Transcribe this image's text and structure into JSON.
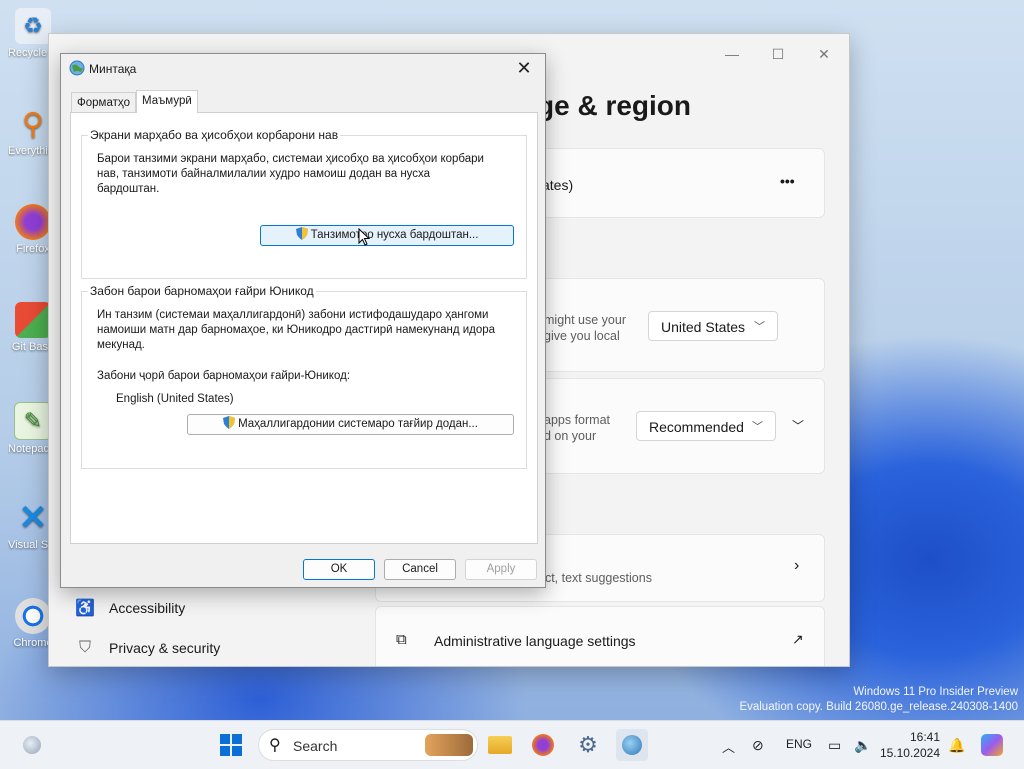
{
  "desktop": {
    "icons": [
      {
        "label": "Recycle Bin",
        "icon": "recycle-bin-icon"
      },
      {
        "label": "Everything",
        "icon": "magnifier-icon"
      },
      {
        "label": "Firefox",
        "icon": "firefox-icon"
      },
      {
        "label": "Git Bash",
        "icon": "git-icon"
      },
      {
        "label": "Notepad++",
        "icon": "notepad-icon"
      },
      {
        "label": "Visual Studio Code",
        "icon": "vscode-icon"
      },
      {
        "label": "Chrome",
        "icon": "chrome-icon"
      }
    ],
    "watermark_line1": "Windows 11 Pro Insider Preview",
    "watermark_line2": "Evaluation copy. Build 26080.ge_release.240308-1400"
  },
  "settings": {
    "title_partial": "ge & region",
    "country_partial": "ates)",
    "more": "•••",
    "region_desc_line1": "might use your",
    "region_desc_line2": "give you local",
    "country_value": "United States",
    "format_desc_line1": "apps format",
    "format_desc_line2": "d on your",
    "format_value": "Recommended",
    "typing_desc": "ect, text suggestions",
    "admin_label": "Administrative language settings",
    "nav": {
      "accessibility": "Accessibility",
      "privacy": "Privacy & security"
    }
  },
  "dialog": {
    "title": "Минтақа",
    "tabs": [
      "Форматҳо",
      "Маъмурӣ"
    ],
    "group1": {
      "label": "Экрани марҳабо ва ҳисобҳои корбарони нав",
      "desc_lines": [
        "Барои танзими экрани марҳабо, системаи ҳисобҳо ва ҳисобҳои корбари",
        "нав, танзимоти байналмилалии худро намоиш додан ва нусха",
        "бардоштан."
      ],
      "button": "Танзимотро нусха бардоштан..."
    },
    "group2": {
      "label": "Забон барои барномаҳои ғайри Юникод",
      "desc_lines": [
        "Ин танзим (системаи маҳаллигардонӣ) забони истифодашударо ҳангоми",
        "намоиши матн дар барномаҳое, ки Юникодро дастгирӣ намекунанд идора",
        "мекунад."
      ],
      "current_label": "Забони ҷорӣ барои барномаҳои ғайри-Юникод:",
      "current_value": "English (United States)",
      "button": "Маҳаллигардонии системаро тағйир додан..."
    },
    "ok": "OK",
    "cancel": "Cancel",
    "apply": "Apply"
  },
  "taskbar": {
    "search_placeholder": "Search",
    "lang": "ENG",
    "time": "16:41",
    "date": "15.10.2024"
  }
}
